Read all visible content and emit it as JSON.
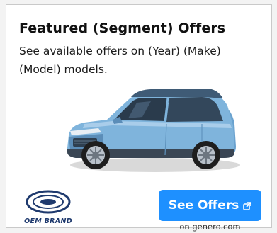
{
  "ad": {
    "headline": "Featured (Segment) Offers",
    "subtext": "See available offers on (Year) (Make) (Model) models.",
    "vehicle_image": "blue-suv-image",
    "logo": {
      "text": "OEM BRAND",
      "icon": "oem-brand-oval-logo"
    },
    "cta": {
      "label": "See Offers",
      "icon": "external-link-icon"
    },
    "cta_note": "on genero.com"
  },
  "colors": {
    "card_background": "#ffffff",
    "page_background": "#f3f3f3",
    "cta_background": "#1e90ff",
    "cta_text": "#ffffff",
    "vehicle_body": "#7fb4dc",
    "logo_text": "#1f3a6e"
  }
}
